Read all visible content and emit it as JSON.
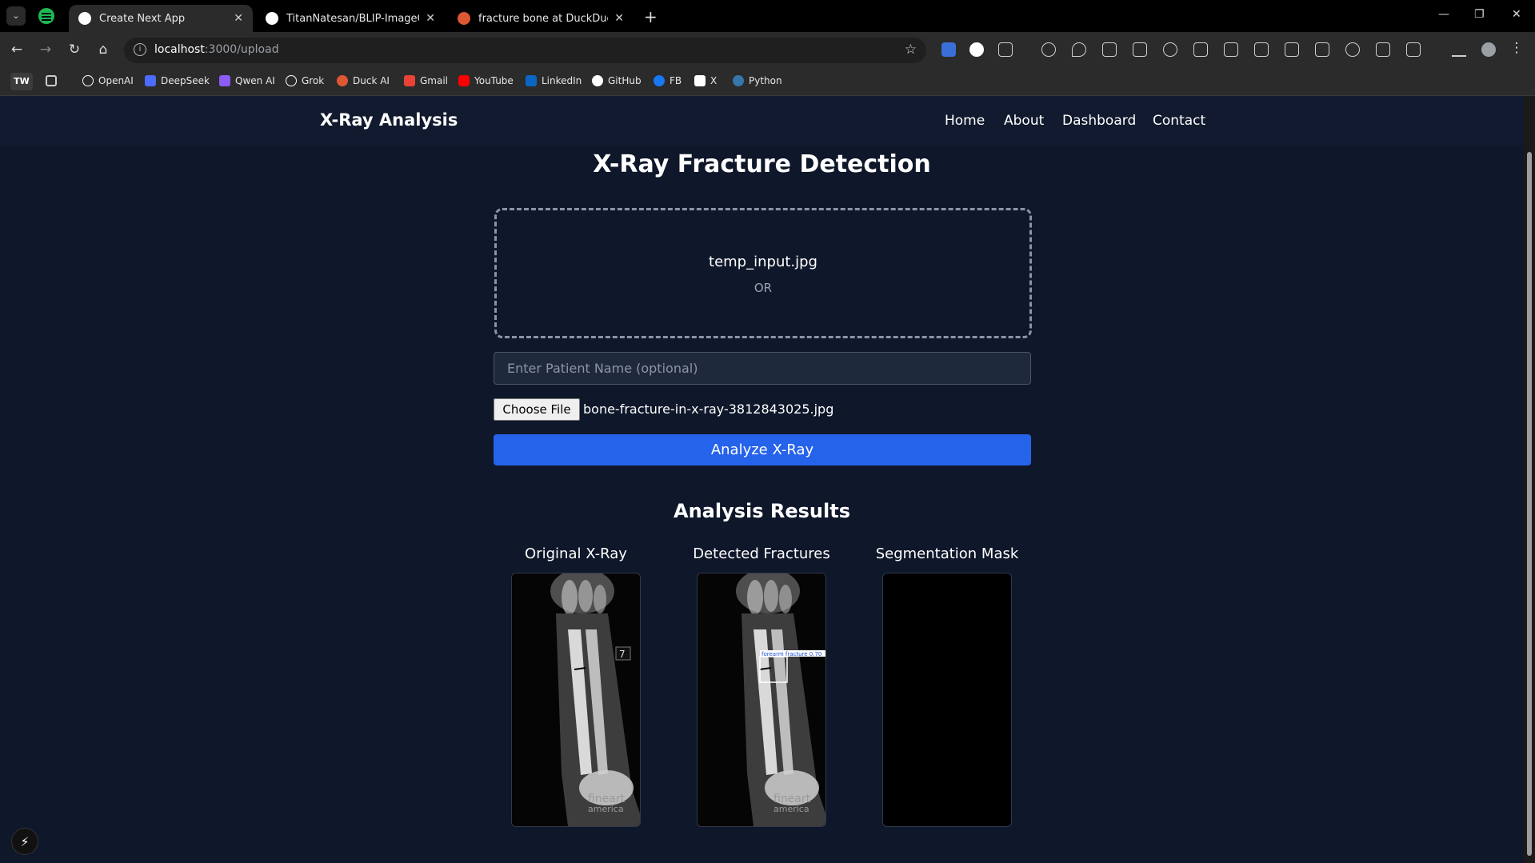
{
  "browser": {
    "tabs": [
      {
        "label": "Create Next App",
        "active": true
      },
      {
        "label": "TitanNatesan/BLIP-ImageCaptio",
        "active": false
      },
      {
        "label": "fracture bone at DuckDuckGo",
        "active": false
      }
    ],
    "url_host": "localhost",
    "url_path": ":3000/upload",
    "bookmarks_badge": "TW",
    "bookmarks": [
      {
        "label": "OpenAI",
        "color": "#ffffff"
      },
      {
        "label": "DeepSeek",
        "color": "#4d6bfe"
      },
      {
        "label": "Qwen AI",
        "color": "#8b5cf6"
      },
      {
        "label": "Grok",
        "color": "#ffffff"
      },
      {
        "label": "Duck AI",
        "color": "#de5833"
      },
      {
        "label": "Gmail",
        "color": "#ea4335"
      },
      {
        "label": "YouTube",
        "color": "#ff0000"
      },
      {
        "label": "LinkedIn",
        "color": "#0a66c2"
      },
      {
        "label": "GitHub",
        "color": "#ffffff"
      },
      {
        "label": "FB",
        "color": "#1877f2"
      },
      {
        "label": "X",
        "color": "#ffffff"
      },
      {
        "label": "Python",
        "color": "#3776ab"
      }
    ]
  },
  "navbar": {
    "brand": "X-Ray Analysis",
    "links": [
      "Home",
      "About",
      "Dashboard",
      "Contact"
    ]
  },
  "main": {
    "title": "X-Ray Fracture Detection",
    "dropzone_file": "temp_input.jpg",
    "dropzone_or": "OR",
    "patient_placeholder": "Enter Patient Name (optional)",
    "choose_file_label": "Choose File",
    "selected_file": "bone-fracture-in-x-ray-3812843025.jpg",
    "analyze_label": "Analyze X-Ray"
  },
  "results": {
    "title": "Analysis Results",
    "panels": [
      {
        "title": "Original X-Ray"
      },
      {
        "title": "Detected Fractures",
        "detection_label": "forearm fracture 0.70"
      },
      {
        "title": "Segmentation Mask"
      }
    ],
    "watermark_line1": "fineart",
    "watermark_line2": "america"
  },
  "colors": {
    "page_bg": "#0f172a",
    "accent": "#2563eb"
  }
}
